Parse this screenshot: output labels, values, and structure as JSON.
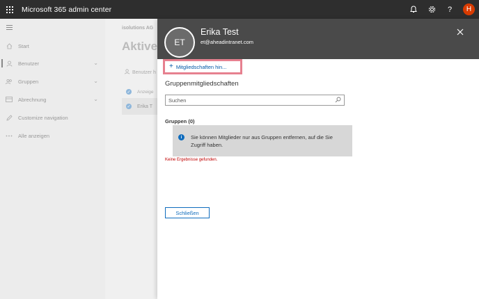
{
  "app": {
    "title": "Microsoft 365 admin center"
  },
  "topbar": {
    "icons": [
      "bell-icon",
      "gear-icon",
      "help-icon"
    ],
    "help_glyph": "?",
    "avatar_initial": "H",
    "avatar_color": "#d83b01"
  },
  "nav": {
    "items": [
      {
        "label": "Start",
        "icon": "home-icon"
      },
      {
        "label": "Benutzer",
        "icon": "person-icon"
      },
      {
        "label": "Gruppen",
        "icon": "group-icon"
      },
      {
        "label": "Abrechnung",
        "icon": "card-icon"
      },
      {
        "label": "Customize navigation",
        "icon": "pencil-icon"
      },
      {
        "label": "Alle anzeigen",
        "icon": "ellipsis-icon"
      }
    ]
  },
  "background": {
    "breadcrumb": "isolutions AG",
    "page_title": "Aktive",
    "add_user_label": "Benutzer h",
    "rows": [
      "Anzeige",
      "Erika T"
    ]
  },
  "panel": {
    "persona_initials": "ET",
    "user_name": "Erika Test",
    "user_email": "et@aheadintranet.com",
    "add_memberships_label": "Mitgliedschaften hin...",
    "section_title": "Gruppenmitgliedschaften",
    "search_placeholder": "Suchen",
    "groups_label": "Gruppen (0)",
    "info_text": "Sie können Mitglieder nur aus Gruppen entfernen, auf die Sie Zugriff haben.",
    "no_results": "Keine Ergebnisse gefunden.",
    "close_button": "Schließen"
  },
  "colors": {
    "accent": "#0f6cbd",
    "highlight_border": "#e6808f",
    "error": "#c00000",
    "header_bg": "#4a4a4a"
  }
}
